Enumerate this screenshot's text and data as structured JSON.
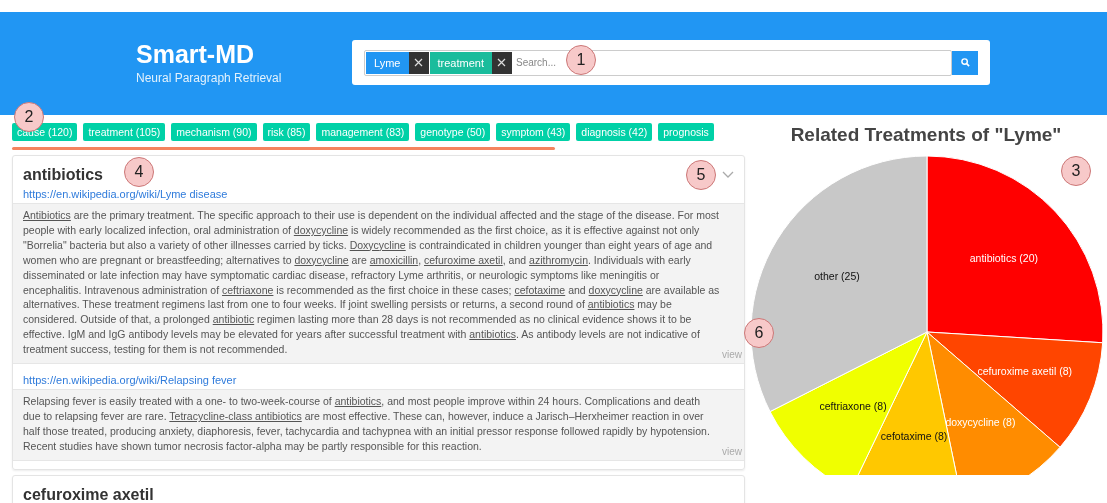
{
  "header": {
    "logo": "Smart-MD",
    "subtitle": "Neural Paragraph Retrieval",
    "search": {
      "tags": [
        {
          "label": "Lyme",
          "kind": "disease"
        },
        {
          "label": "treatment",
          "kind": "aspect"
        }
      ],
      "placeholder": "Search..."
    }
  },
  "categories": [
    {
      "label": "cause (120)"
    },
    {
      "label": "treatment (105)"
    },
    {
      "label": "mechanism (90)"
    },
    {
      "label": "risk (85)"
    },
    {
      "label": "management (83)"
    },
    {
      "label": "genotype (50)"
    },
    {
      "label": "symptom (43)"
    },
    {
      "label": "diagnosis (42)"
    },
    {
      "label": "prognosis"
    }
  ],
  "results": [
    {
      "title": "antibiotics",
      "sources": [
        {
          "url": "https://en.wikipedia.org/wiki/Lyme disease",
          "view": "view",
          "paragraph": [
            {
              "text": "Antibiotics",
              "kind": "term"
            },
            {
              "text": " are the primary treatment. The specific approach to their use is dependent on the individual affected and the stage of the disease. For most people with early localized infection, oral administration of ",
              "kind": "text"
            },
            {
              "text": "doxycycline",
              "kind": "term"
            },
            {
              "text": " is widely recommended as the first choice, as it is effective against not only \"Borrelia\" bacteria but also a variety of other illnesses carried by ticks. ",
              "kind": "text"
            },
            {
              "text": "Doxycycline",
              "kind": "term"
            },
            {
              "text": " is contraindicated in children younger than eight years of age and women who are pregnant or breastfeeding; alternatives to ",
              "kind": "text"
            },
            {
              "text": "doxycycline",
              "kind": "term"
            },
            {
              "text": " are ",
              "kind": "text"
            },
            {
              "text": "amoxicillin",
              "kind": "term"
            },
            {
              "text": ", ",
              "kind": "text"
            },
            {
              "text": "cefuroxime axetil",
              "kind": "term"
            },
            {
              "text": ", and ",
              "kind": "text"
            },
            {
              "text": "azithromycin",
              "kind": "term"
            },
            {
              "text": ". Individuals with early disseminated or late infection may have symptomatic cardiac disease, refractory Lyme arthritis, or neurologic symptoms like meningitis or encephalitis. Intravenous administration of ",
              "kind": "text"
            },
            {
              "text": "ceftriaxone",
              "kind": "term"
            },
            {
              "text": " is recommended as the first choice in these cases; ",
              "kind": "text"
            },
            {
              "text": "cefotaxime",
              "kind": "term"
            },
            {
              "text": " and ",
              "kind": "text"
            },
            {
              "text": "doxycycline",
              "kind": "term"
            },
            {
              "text": " are available as alternatives. These treatment regimens last from one to four weeks. If joint swelling persists or returns, a second round of ",
              "kind": "text"
            },
            {
              "text": "antibiotics",
              "kind": "term"
            },
            {
              "text": " may be considered. Outside of that, a prolonged ",
              "kind": "text"
            },
            {
              "text": "antibiotic",
              "kind": "term"
            },
            {
              "text": " regimen lasting more than 28 days is not recommended as no clinical evidence shows it to be effective. IgM and IgG antibody levels may be elevated for years after successful treatment with ",
              "kind": "text"
            },
            {
              "text": "antibiotics",
              "kind": "term"
            },
            {
              "text": ". As antibody levels are not indicative of treatment success, testing for them is not recommended.",
              "kind": "text"
            }
          ]
        },
        {
          "url": "https://en.wikipedia.org/wiki/Relapsing fever",
          "view": "view",
          "paragraph": [
            {
              "text": "Relapsing fever is easily treated with a one- to two-week-course of ",
              "kind": "text"
            },
            {
              "text": "antibiotics",
              "kind": "term"
            },
            {
              "text": ", and most people improve within 24 hours. Complications and death due to relapsing fever are rare. ",
              "kind": "text"
            },
            {
              "text": "Tetracycline-class antibiotics",
              "kind": "term"
            },
            {
              "text": " are most effective. These can, however, induce a Jarisch–Herxheimer reaction in over half those treated, producing anxiety, diaphoresis, fever, tachycardia and tachypnea with an initial pressor response followed rapidly by hypotension. Recent studies have shown tumor necrosis factor-alpha may be partly responsible for this reaction.",
              "kind": "text"
            }
          ]
        }
      ]
    },
    {
      "title": "cefuroxime axetil"
    }
  ],
  "chart": {
    "chart_data": {
      "type": "pie",
      "title": "Related Treatments of \"Lyme\"",
      "values": [
        20,
        8,
        8,
        8,
        8,
        25
      ],
      "colors": [
        "#ff0000",
        "#ff4500",
        "#ff8c00",
        "#ffc800",
        "#f0ff00",
        "#c8c8c8"
      ],
      "value_labels": [
        "antibiotics (20)",
        "cefuroxime axetil (8)",
        "doxycycline (8)",
        "cefotaxime (8)",
        "ceftriaxone (8)",
        "other (25)"
      ]
    }
  },
  "callouts": [
    "1",
    "2",
    "4",
    "5",
    "3",
    "6"
  ]
}
